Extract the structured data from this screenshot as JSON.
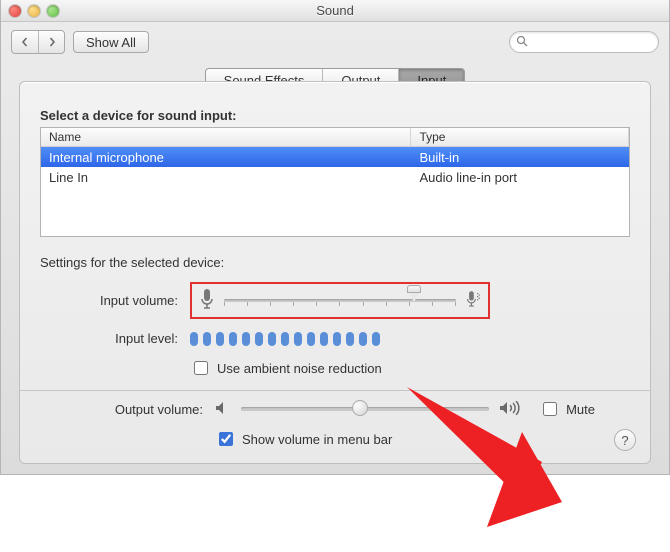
{
  "window": {
    "title": "Sound"
  },
  "toolbar": {
    "show_all": "Show All",
    "search_placeholder": ""
  },
  "tabs": [
    {
      "label": "Sound Effects",
      "active": false
    },
    {
      "label": "Output",
      "active": false
    },
    {
      "label": "Input",
      "active": true
    }
  ],
  "devices": {
    "heading": "Select a device for sound input:",
    "columns": {
      "name": "Name",
      "type": "Type"
    },
    "rows": [
      {
        "name": "Internal microphone",
        "type": "Built-in",
        "selected": true
      },
      {
        "name": "Line In",
        "type": "Audio line-in port",
        "selected": false
      }
    ]
  },
  "settings": {
    "heading": "Settings for the selected device:",
    "input_volume_label": "Input volume:",
    "input_volume_value": 82,
    "input_level_label": "Input level:",
    "input_level_bars_on": 15,
    "input_level_bars_total": 15,
    "ambient_label": "Use ambient noise reduction",
    "ambient_checked": false
  },
  "footer": {
    "output_volume_label": "Output volume:",
    "output_volume_value": 48,
    "mute_label": "Mute",
    "mute_checked": false,
    "show_in_menu_label": "Show volume in menu bar",
    "show_in_menu_checked": true
  },
  "help": "?"
}
